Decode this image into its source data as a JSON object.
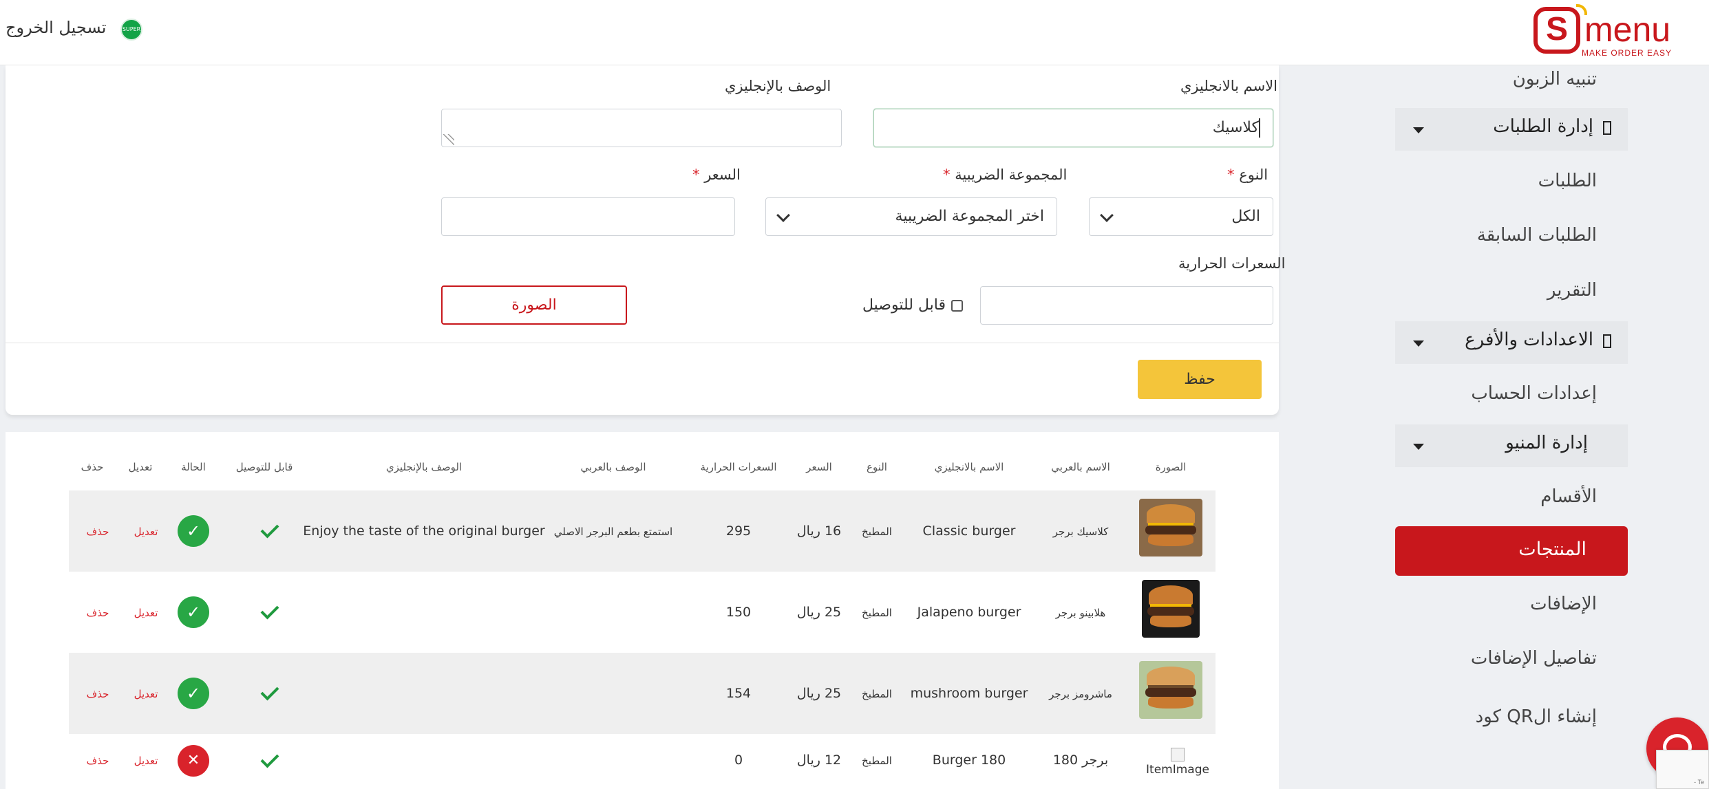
{
  "header": {
    "logout": "تسجيل الخروج",
    "flag_text": "SUPER",
    "logo_word": "menu",
    "logo_letter": "S",
    "logo_tagline": "MAKE ORDER EASY"
  },
  "sidebar": {
    "customer_alert": "تنبيه الزبون",
    "orders_section": "إدارة الطلبات",
    "orders": "الطلبات",
    "previous_orders": "الطلبات السابقة",
    "report": "التقرير",
    "settings_section": "الاعدادات والأفرع",
    "account_settings": "إعدادات الحساب",
    "menu_section": "إدارة المنيو",
    "categories": "الأقسام",
    "products": "المنتجات",
    "addons": "الإضافات",
    "addon_details": "تفاصيل الإضافات",
    "qr_code": "إنشاء الQR كود"
  },
  "form": {
    "name_en_label": "الاسم بالانجليزي",
    "name_en_value": "كلاسيك",
    "desc_en_label": "الوصف بالإنجليزي",
    "desc_en_value": "",
    "type_label": "النوع",
    "type_value": "الكل",
    "tax_label": "المجموعة الضريبية",
    "tax_value": "اختر المجموعة الضريبية",
    "price_label": "السعر",
    "price_value": "",
    "calories_label": "السعرات الحرارية",
    "calories_value": "",
    "deliverable_label": "قابل للتوصيل",
    "deliverable_checked": false,
    "image_button": "الصورة",
    "save_button": "حفظ",
    "required_mark": "*"
  },
  "table": {
    "headers": {
      "image": "الصورة",
      "name_ar": "الاسم بالعربي",
      "name_en": "الاسم بالانجليزي",
      "type": "النوع",
      "price": "السعر",
      "calories": "السعرات الحرارية",
      "desc_ar": "الوصف بالعربي",
      "desc_en": "الوصف بالإنجليزي",
      "deliverable": "قابل للتوصيل",
      "status": "الحالة",
      "edit": "تعديل",
      "delete": "حذف"
    },
    "rows": [
      {
        "name_ar": "كلاسيك برجر",
        "name_en": "Classic burger",
        "type": "المطبخ",
        "price": "16 ريال",
        "calories": "295",
        "desc_ar": "استمتع بطعم البرجر الاصلي",
        "desc_en": "Enjoy the taste of the original burger",
        "status": "active",
        "edit": "تعديل",
        "delete": "حذف"
      },
      {
        "name_ar": "هلابينو برجر",
        "name_en": "Jalapeno burger",
        "type": "المطبخ",
        "price": "25 ريال",
        "calories": "150",
        "desc_ar": "",
        "desc_en": "",
        "status": "active",
        "edit": "تعديل",
        "delete": "حذف"
      },
      {
        "name_ar": "ماشرومز برجر",
        "name_en": "mushroom burger",
        "type": "المطبخ",
        "price": "25 ريال",
        "calories": "154",
        "desc_ar": "",
        "desc_en": "",
        "status": "active",
        "edit": "تعديل",
        "delete": "حذف"
      },
      {
        "name_ar": "برجر 180",
        "name_en": "Burger 180",
        "type": "المطبخ",
        "price": "12 ريال",
        "calories": "0",
        "desc_ar": "",
        "desc_en": "",
        "status": "inactive",
        "image_alt": "ItemImage",
        "edit": "تعديل",
        "delete": "حذف"
      }
    ]
  },
  "colors": {
    "brand_red": "#c8171c",
    "save_yellow": "#f4c53a",
    "success_green": "#28a745",
    "danger_red": "#d9232b"
  },
  "icons": [
    "saudi-flag-icon",
    "checkmark-icon",
    "close-icon",
    "chevron-down-icon",
    "chat-icon"
  ]
}
